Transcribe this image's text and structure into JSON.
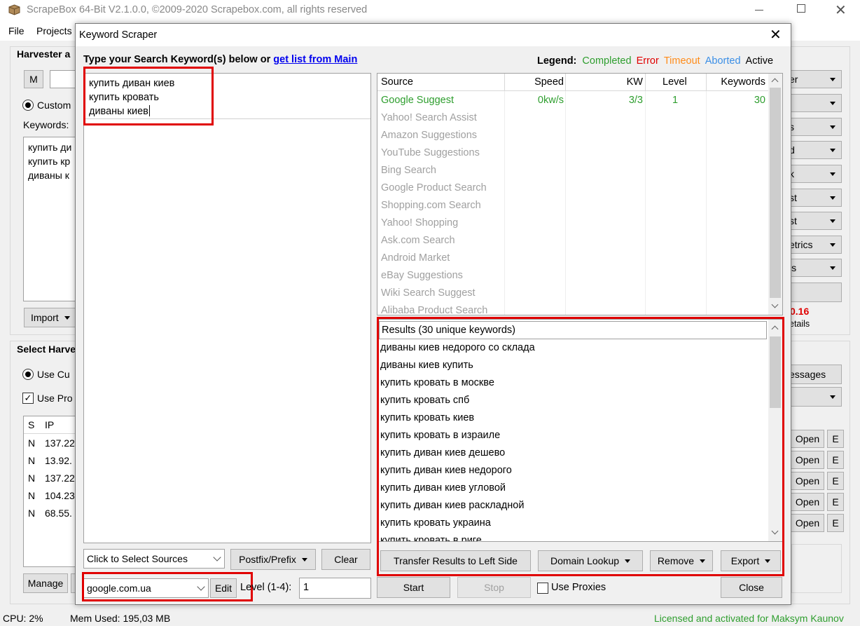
{
  "main_window": {
    "title": "ScrapeBox 64-Bit V2.1.0.0, ©2009-2020 Scrapebox.com, all rights reserved",
    "menu": [
      "File",
      "Projects"
    ],
    "harvester_title": "Harvester a",
    "m_button": "M",
    "custom_radio": "Custom",
    "keywords_label": "Keywords:",
    "keywords_preview": [
      "купить ди",
      "купить кр",
      "диваны к"
    ],
    "import_button": "Import",
    "select_harvester_title": "Select Harve",
    "use_custom_radio": "Use Cu",
    "use_proxy_check": "Use Pro",
    "proxy_headers": [
      "S",
      "IP"
    ],
    "proxy_rows": [
      {
        "s": "N",
        "ip": "137.22"
      },
      {
        "s": "N",
        "ip": "13.92."
      },
      {
        "s": "N",
        "ip": "137.22"
      },
      {
        "s": "N",
        "ip": "104.23"
      },
      {
        "s": "N",
        "ip": "68.55."
      }
    ],
    "manage_button": "Manage",
    "right_dropdowns": [
      "er",
      "",
      "s",
      "d",
      "k",
      "st",
      "st",
      "etrics",
      "ls"
    ],
    "value_red": "0.16",
    "details_text": "etails",
    "messages_button": "essages",
    "open_label": "Open",
    "e_label": "E",
    "status": {
      "cpu": "CPU:  2%",
      "mem": "Mem Used:  195,03 MB",
      "license": "Licensed and activated for Maksym Kaunov"
    }
  },
  "dialog": {
    "title": "Keyword Scraper",
    "prompt_text": "Type your Search Keyword(s) below or ",
    "prompt_link": "get list from Main",
    "keywords": [
      "купить диван киев",
      "купить кровать",
      "диваны киев"
    ],
    "legend": {
      "label": "Legend:",
      "completed": "Completed",
      "error": "Error",
      "timeout": "Timeout",
      "aborted": "Aborted",
      "active": "Active"
    },
    "sources_table": {
      "headers": [
        "Source",
        "Speed",
        "KW",
        "Level",
        "Keywords"
      ],
      "active_row": {
        "source": "Google Suggest",
        "speed": "0kw/s",
        "kw": "3/3",
        "level": "1",
        "keywords": "30"
      },
      "other_sources": [
        "Yahoo! Search Assist",
        "Amazon Suggestions",
        "YouTube Suggestions",
        "Bing Search",
        "Google Product Search",
        "Shopping.com Search",
        "Yahoo! Shopping",
        "Ask.com Search",
        "Android Market",
        "eBay Suggestions",
        "Wiki Search Suggest",
        "Alibaba Product Search"
      ]
    },
    "results": {
      "header": "Results (30 unique keywords)",
      "items": [
        "диваны киев недорого со склада",
        "диваны киев купить",
        "купить кровать в москве",
        "купить кровать спб",
        "купить кровать киев",
        "купить кровать в израиле",
        "купить диван киев дешево",
        "купить диван киев недорого",
        "купить диван киев угловой",
        "купить диван киев раскладной",
        "купить кровать украина",
        "купить кровать в риге"
      ]
    },
    "select_sources": "Click to Select Sources",
    "postfix_button": "Postfix/Prefix",
    "clear_button": "Clear",
    "domain_value": "google.com.ua",
    "edit_button": "Edit",
    "level_label": "Level (1-4):",
    "level_value": "1",
    "transfer_button": "Transfer Results to Left Side",
    "domain_lookup_button": "Domain Lookup",
    "remove_button": "Remove",
    "export_button": "Export",
    "start_button": "Start",
    "stop_button": "Stop",
    "use_proxies_label": "Use Proxies",
    "close_button": "Close"
  },
  "colors": {
    "completed": "#2e9e2e",
    "error": "#e00000",
    "timeout": "#ff8c1a",
    "aborted": "#3a8ee6",
    "inactive_source": "#a0a0a0",
    "highlight_box": "#e00000",
    "license_green": "#2e9e2e",
    "link_blue": "#0000ee"
  },
  "icons": [
    "scrapebox-box-icon",
    "minimize-icon",
    "maximize-icon",
    "close-icon",
    "chevron-down-icon",
    "scroll-up-icon",
    "scroll-down-icon"
  ]
}
